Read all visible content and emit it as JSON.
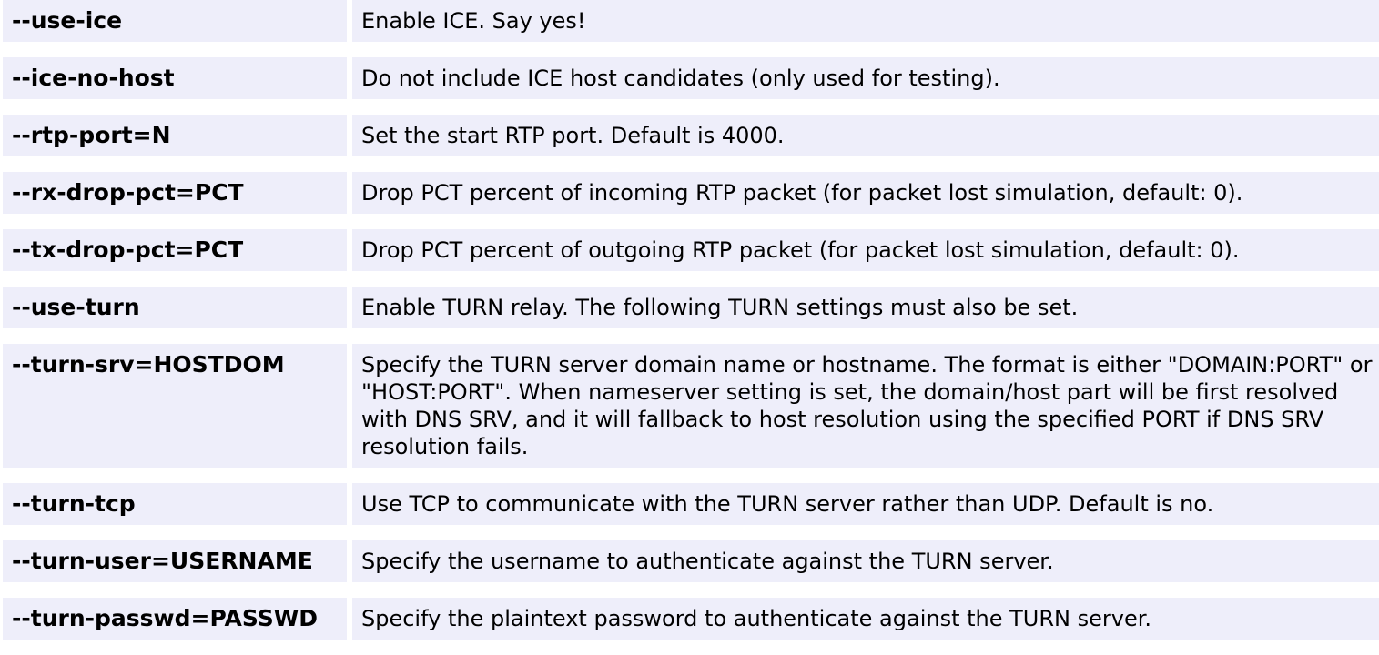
{
  "options": [
    {
      "name": "--use-ice",
      "desc": "Enable ICE. Say yes!"
    },
    {
      "name": "--ice-no-host",
      "desc": "Do not include ICE host candidates (only used for testing)."
    },
    {
      "name": "--rtp-port=N",
      "desc": "Set the start RTP port. Default is 4000."
    },
    {
      "name": "--rx-drop-pct=PCT",
      "desc": "Drop PCT percent of incoming RTP packet (for packet lost simulation, default: 0)."
    },
    {
      "name": "--tx-drop-pct=PCT",
      "desc": "Drop PCT percent of outgoing RTP packet (for packet lost simulation, default: 0)."
    },
    {
      "name": "--use-turn",
      "desc": "Enable TURN relay. The following TURN settings must also be set."
    },
    {
      "name": "--turn-srv=HOSTDOM",
      "desc": "Specify the TURN server domain name or hostname. The format is either \"DOMAIN:PORT\" or \"HOST:PORT\". When nameserver setting is set, the domain/host part will be first resolved with DNS SRV, and it will fallback to host resolution using the specified PORT if DNS SRV resolution fails."
    },
    {
      "name": "--turn-tcp",
      "desc": "Use TCP to communicate with the TURN server rather than UDP. Default is no."
    },
    {
      "name": "--turn-user=USERNAME",
      "desc": "Specify the username to authenticate against the TURN server."
    },
    {
      "name": "--turn-passwd=PASSWD",
      "desc": "Specify the plaintext password to authenticate against the TURN server."
    }
  ]
}
